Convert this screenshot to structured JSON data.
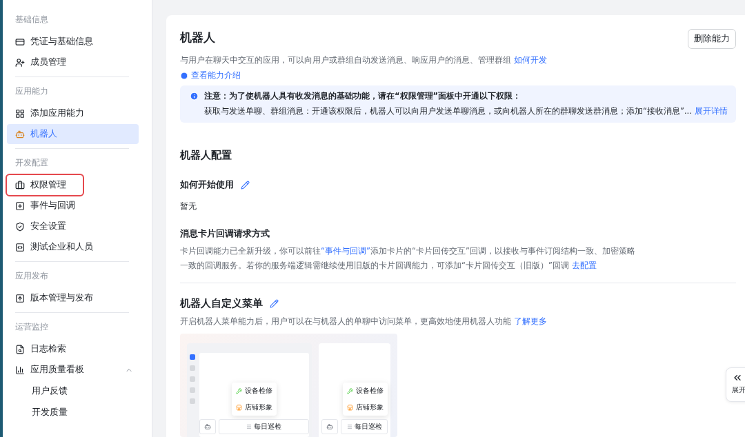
{
  "sidebar": {
    "groups": [
      {
        "title": "基础信息",
        "items": [
          {
            "label": "凭证与基础信息",
            "selected": false,
            "highlighted": false
          },
          {
            "label": "成员管理",
            "selected": false,
            "highlighted": false
          }
        ]
      },
      {
        "title": "应用能力",
        "items": [
          {
            "label": "添加应用能力",
            "selected": false,
            "highlighted": false
          },
          {
            "label": "机器人",
            "selected": true,
            "highlighted": false
          }
        ]
      },
      {
        "title": "开发配置",
        "items": [
          {
            "label": "权限管理",
            "selected": false,
            "highlighted": true
          },
          {
            "label": "事件与回调",
            "selected": false,
            "highlighted": false
          },
          {
            "label": "安全设置",
            "selected": false,
            "highlighted": false
          },
          {
            "label": "测试企业和人员",
            "selected": false,
            "highlighted": false
          }
        ]
      },
      {
        "title": "应用发布",
        "items": [
          {
            "label": "版本管理与发布",
            "selected": false,
            "highlighted": false
          }
        ]
      },
      {
        "title": "运营监控",
        "items": [
          {
            "label": "日志检索",
            "selected": false,
            "highlighted": false
          },
          {
            "label": "应用质量看板",
            "selected": false,
            "highlighted": false,
            "expanded": true,
            "children": [
              {
                "label": "用户反馈",
                "selected": false
              },
              {
                "label": "开发质量",
                "selected": false
              }
            ]
          }
        ]
      }
    ]
  },
  "main": {
    "title": "机器人",
    "delete_button": "删除能力",
    "description": "与用户在聊天中交互的应用，可以向用户或群组自动发送消息、响应用户的消息、管理群组",
    "description_link": "如何开发",
    "intro_link": "查看能力介绍",
    "notice": {
      "title": "注意：为了使机器人具有收发消息的基础功能，请在“权限管理”面板中开通以下权限：",
      "body": "获取与发送单聊、群组消息：开通该权限后，机器人可以向用户发送单聊消息，或向机器人所在的群聊发送群消息；添加“接收消息”...",
      "link": "展开详情"
    },
    "config": {
      "heading": "机器人配置",
      "usage_title": "如何开始使用",
      "usage_value": "暂无",
      "callback_title": "消息卡片回调请求方式",
      "callback_text": [
        {
          "text": "卡片回调能力已全新升级，你可以前往",
          "kind": "text"
        },
        {
          "text": "“事件与回调”",
          "kind": "link"
        },
        {
          "text": "添加卡片的“卡片回传交互”回调，以接收与事件订阅结构一致、加密策略一致的回调服务。若你的服务端逻辑需继续使用旧版的卡片回调能力，可添加“卡片回传交互（旧版）”回调 ",
          "kind": "text"
        },
        {
          "text": "去配置",
          "kind": "link"
        }
      ]
    },
    "menu": {
      "title": "机器人自定义菜单",
      "description": "开启机器人菜单能力后，用户可以在与机器人的单聊中访问菜单，更高效地使用机器人功能",
      "link": "了解更多",
      "preview": {
        "desktop_popup": [
          "设备检修",
          "店铺形象"
        ],
        "desktop_bar": "每日巡检",
        "mobile_popup": [
          "设备检修",
          "店铺形象"
        ],
        "mobile_bar": "每日巡检"
      }
    }
  },
  "expand_tab": {
    "label": "展开"
  }
}
